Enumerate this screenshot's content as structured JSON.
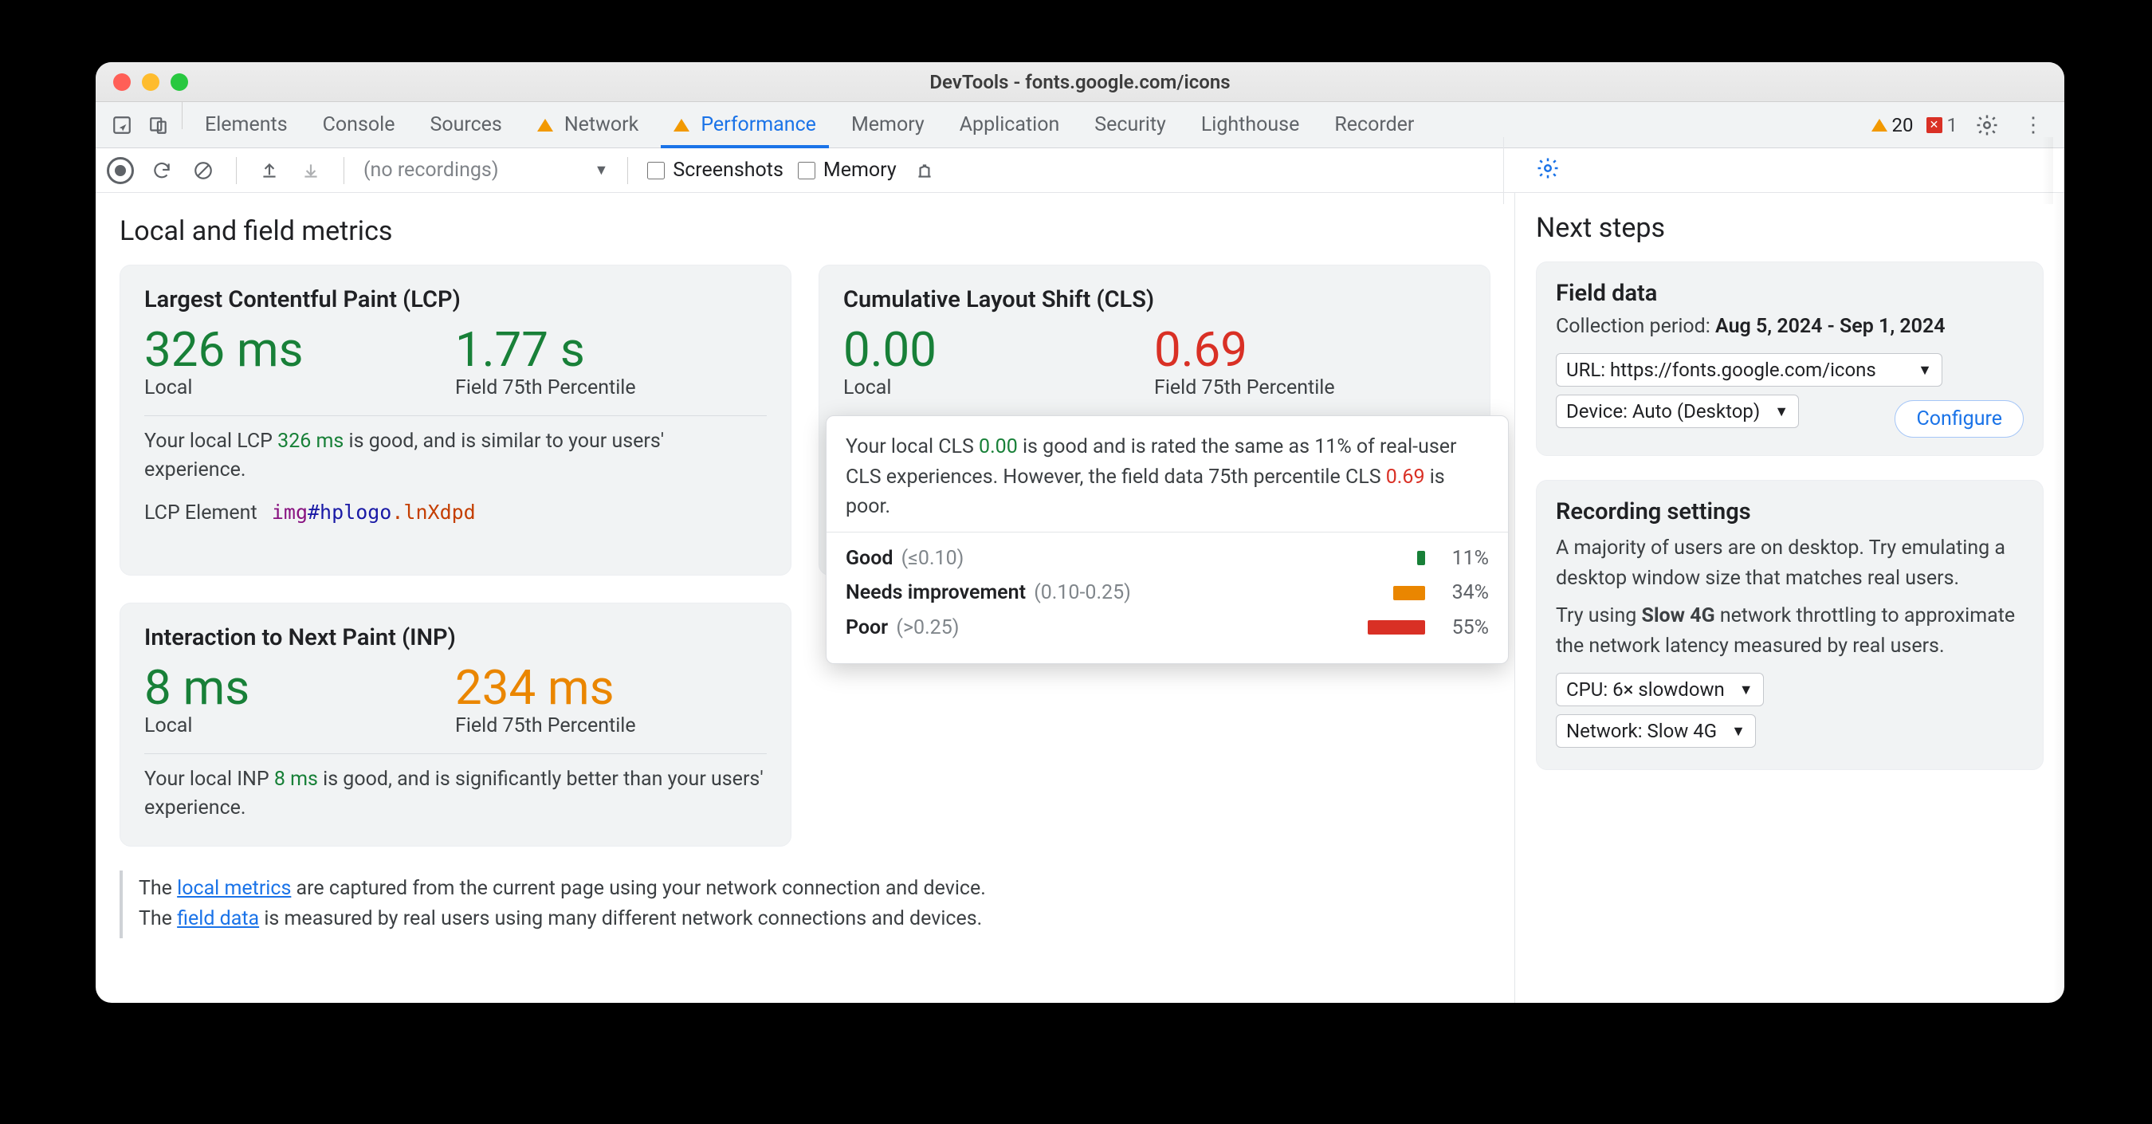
{
  "window": {
    "title": "DevTools - fonts.google.com/icons"
  },
  "tabs": {
    "items": [
      "Elements",
      "Console",
      "Sources",
      "Network",
      "Performance",
      "Memory",
      "Application",
      "Security",
      "Lighthouse",
      "Recorder"
    ],
    "active": "Performance",
    "warnTabs": [
      "Network",
      "Performance"
    ]
  },
  "issueCounts": {
    "warnings": "20",
    "errors": "1"
  },
  "toolbar": {
    "recordings_placeholder": "(no recordings)",
    "screenshots_label": "Screenshots",
    "memory_label": "Memory"
  },
  "leftTitle": "Local and field metrics",
  "lcp": {
    "title": "Largest Contentful Paint (LCP)",
    "local": "326 ms",
    "localLabel": "Local",
    "field": "1.77 s",
    "fieldLabel": "Field 75th Percentile",
    "desc_a": "Your local LCP ",
    "desc_val": "326 ms",
    "desc_b": " is good, and is similar to your users' experience.",
    "elementLabel": "LCP Element",
    "el_tag": "img",
    "el_id": "#hplogo",
    "el_cls": ".lnXdpd"
  },
  "cls": {
    "title": "Cumulative Layout Shift (CLS)",
    "local": "0.00",
    "localLabel": "Local",
    "field": "0.69",
    "fieldLabel": "Field 75th Percentile",
    "tip_a": "Your local CLS ",
    "tip_local": "0.00",
    "tip_b": " is good and is rated the same as 11% of real-user CLS experiences. However, the field data 75th percentile CLS ",
    "tip_field": "0.69",
    "tip_c": " is poor.",
    "dist": [
      {
        "label": "Good",
        "range": "(≤0.10)",
        "pct": "11%",
        "barW": 10,
        "cls": "good-b"
      },
      {
        "label": "Needs improvement",
        "range": "(0.10-0.25)",
        "pct": "34%",
        "barW": 40,
        "cls": "ni-b"
      },
      {
        "label": "Poor",
        "range": "(>0.25)",
        "pct": "55%",
        "barW": 72,
        "cls": "poor-b"
      }
    ]
  },
  "inp": {
    "title": "Interaction to Next Paint (INP)",
    "local": "8 ms",
    "localLabel": "Local",
    "field": "234 ms",
    "fieldLabel": "Field 75th Percentile",
    "desc_a": "Your local INP ",
    "desc_val": "8 ms",
    "desc_b": " is good, and is significantly better than your users' experience."
  },
  "note": {
    "line1a": "The ",
    "link1": "local metrics",
    "line1b": " are captured from the current page using your network connection and device.",
    "line2a": "The ",
    "link2": "field data",
    "line2b": " is measured by real users using many different network connections and devices."
  },
  "rightTitle": "Next steps",
  "fieldData": {
    "title": "Field data",
    "periodLabel": "Collection period: ",
    "period": "Aug 5, 2024 - Sep 1, 2024",
    "urlSelect": "URL: https://fonts.google.com/icons",
    "deviceSelect": "Device: Auto (Desktop)",
    "configure": "Configure"
  },
  "recSettings": {
    "title": "Recording settings",
    "p1a": "A majority of users are on desktop. Try emulating a desktop window size that matches real users.",
    "p2a": "Try using ",
    "p2b": "Slow 4G",
    "p2c": " network throttling to approximate the network latency measured by real users.",
    "cpuSelect": "CPU: 6× slowdown",
    "netSelect": "Network: Slow 4G"
  }
}
